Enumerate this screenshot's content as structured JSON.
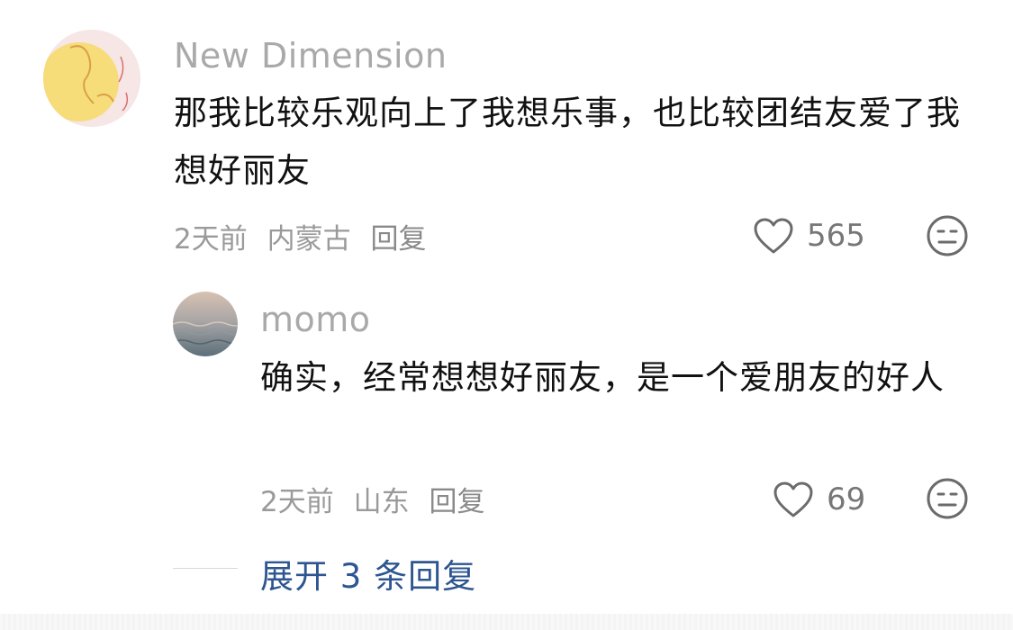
{
  "comments": [
    {
      "username": "New Dimension",
      "text": "那我比较乐观向上了我想乐事，也比较团结友爱了我想好丽友",
      "time": "2天前",
      "location": "内蒙古",
      "reply_label": "回复",
      "likes": "565",
      "like_icon": "heart-outline-icon",
      "dislike_icon": "meh-face-icon"
    },
    {
      "username": "momo",
      "text": "确实，经常想想好丽友，是一个爱朋友的好人",
      "time": "2天前",
      "location": "山东",
      "reply_label": "回复",
      "likes": "69",
      "like_icon": "heart-outline-icon",
      "dislike_icon": "meh-face-icon"
    }
  ],
  "expand_replies": "展开 3 条回复",
  "colors": {
    "link_blue": "#2d5590",
    "meta_gray": "#9a9a9a",
    "name_gray": "#a9a9a9"
  }
}
